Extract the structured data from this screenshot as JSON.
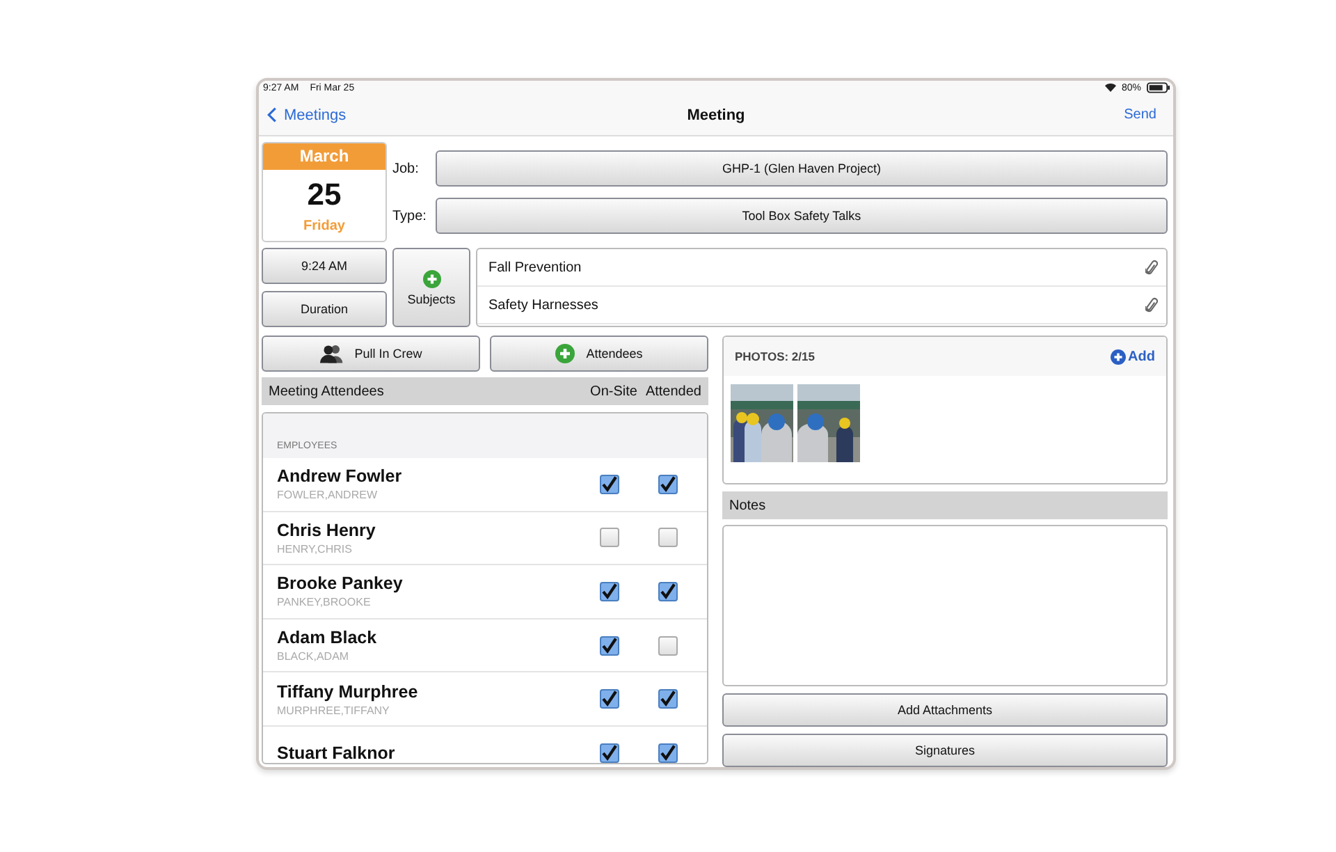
{
  "status_bar": {
    "time": "9:27 AM",
    "date": "Fri Mar 25",
    "battery": "80%"
  },
  "nav": {
    "back": "Meetings",
    "title": "Meeting",
    "action": "Send"
  },
  "date": {
    "month": "March",
    "day": "25",
    "weekday": "Friday"
  },
  "fields": [
    {
      "label": "Job:",
      "value": "GHP-1 (Glen Haven Project)"
    },
    {
      "label": "Type:",
      "value": "Tool Box Safety Talks"
    }
  ],
  "time_button": "9:24 AM",
  "duration_button": "Duration",
  "subjects_button": "Subjects",
  "subjects": [
    "Fall Prevention",
    "Safety Harnesses"
  ],
  "crew_button": "Pull In Crew",
  "attendees_button": "Attendees",
  "attendees_header": {
    "title": "Meeting Attendees",
    "col_1": "On-Site",
    "col_2": "Attended"
  },
  "section": "EMPLOYEES",
  "attendees": [
    {
      "name": "Andrew Fowler",
      "sub": "FOWLER,ANDREW",
      "on_site": true,
      "attended": true
    },
    {
      "name": "Chris Henry",
      "sub": "HENRY,CHRIS",
      "on_site": false,
      "attended": false
    },
    {
      "name": "Brooke Pankey",
      "sub": "PANKEY,BROOKE",
      "on_site": true,
      "attended": true
    },
    {
      "name": "Adam Black",
      "sub": "BLACK,ADAM",
      "on_site": true,
      "attended": false
    },
    {
      "name": "Tiffany Murphree",
      "sub": "MURPHREE,TIFFANY",
      "on_site": true,
      "attended": true
    },
    {
      "name": "Stuart Falknor",
      "on_site": true,
      "attended": true
    }
  ],
  "photos": {
    "title": "PHOTOS: 2/15",
    "add": "Add"
  },
  "notes": {
    "title": "Notes"
  },
  "bottom_buttons": [
    "Add Attachments",
    "Signatures"
  ]
}
